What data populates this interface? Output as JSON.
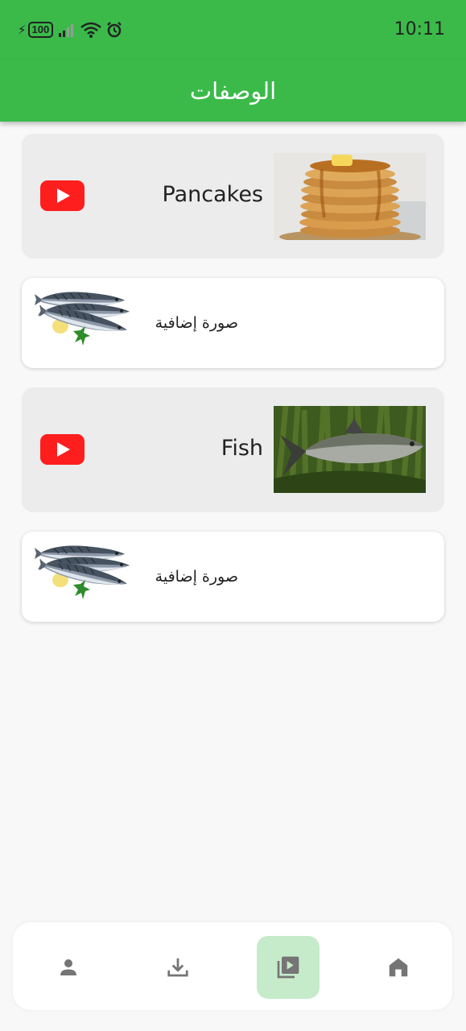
{
  "status_bar": {
    "time": "10:11",
    "battery_level": "100",
    "icons": [
      "charging-icon",
      "battery-icon",
      "signal-icon",
      "wifi-icon",
      "alarm-icon"
    ]
  },
  "app_bar": {
    "title": "الوصفات"
  },
  "items": [
    {
      "type": "recipe",
      "name": "Pancakes",
      "thumbnail": "pancakes-image",
      "video_icon": "youtube-icon"
    },
    {
      "type": "extra",
      "label": "صورة إضافية",
      "thumbnail": "mackerel-image"
    },
    {
      "type": "recipe",
      "name": "Fish",
      "thumbnail": "fish-image",
      "video_icon": "youtube-icon"
    },
    {
      "type": "extra",
      "label": "صورة إضافية",
      "thumbnail": "mackerel-image"
    }
  ],
  "bottom_nav": {
    "items": [
      {
        "icon": "person-icon",
        "active": false
      },
      {
        "icon": "download-icon",
        "active": false
      },
      {
        "icon": "video-library-icon",
        "active": true
      },
      {
        "icon": "home-icon",
        "active": false
      }
    ]
  },
  "colors": {
    "primary": "#3bba4a",
    "active_nav_bg": "#c6ebcb",
    "youtube_red": "#ff1e1e",
    "recipe_card_bg": "#ececec"
  }
}
